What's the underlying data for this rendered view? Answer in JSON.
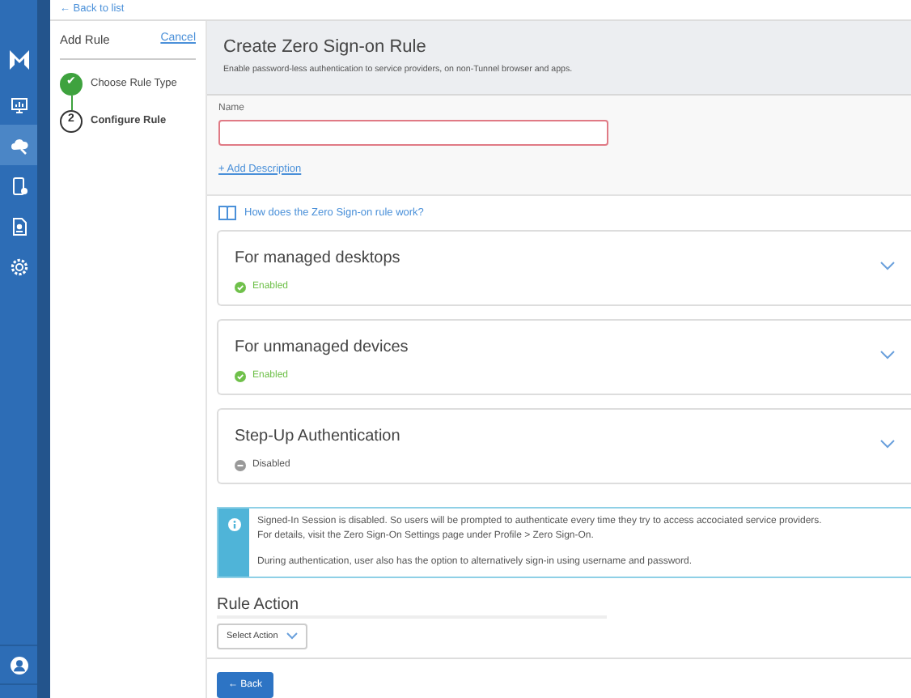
{
  "nav": {
    "back": "← Back to list"
  },
  "sidebar": {
    "items": [
      {
        "selected": false
      },
      {
        "selected": true
      },
      {
        "selected": false
      },
      {
        "selected": false
      },
      {
        "selected": false
      }
    ]
  },
  "steps_panel": {
    "title": "Add Rule",
    "cancel": "Cancel",
    "steps": [
      {
        "marker": "✔",
        "label": "Choose Rule Type",
        "completed": true
      },
      {
        "marker": "2",
        "label": "Configure Rule",
        "completed": false
      }
    ]
  },
  "header": {
    "title": "Create Zero Sign-on Rule",
    "subtitle": "Enable password-less authentication to service providers, on non-Tunnel browser and apps."
  },
  "form": {
    "name_label": "Name",
    "name_invalid": true,
    "add_description": "+ Add Description"
  },
  "help_link": "How does the Zero Sign-on rule work?",
  "sections": [
    {
      "title": "For managed desktops",
      "status": "Enabled",
      "enabled": true
    },
    {
      "title": "For unmanaged devices",
      "status": "Enabled",
      "enabled": true
    },
    {
      "title": "Step-Up Authentication",
      "status": "Disabled",
      "enabled": false
    }
  ],
  "alert": {
    "lines": [
      "Signed-In Session is disabled. So users will be prompted to authenticate every time they try to access accociated service providers.",
      "For details, visit the Zero Sign-On Settings page under Profile > Zero Sign-On.",
      "During authentication, user also has the option to alternatively sign-in using username and password."
    ]
  },
  "rule_action": {
    "heading": "Rule Action",
    "select": "Select Action"
  },
  "back_button": "← Back"
}
